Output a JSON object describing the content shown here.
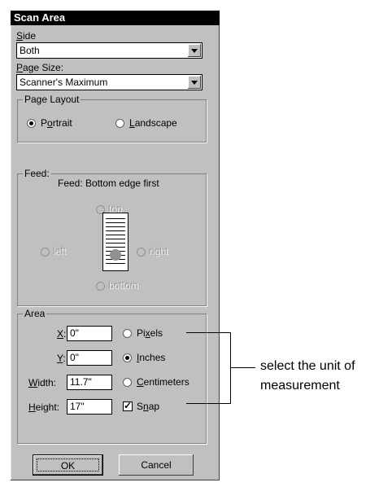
{
  "window": {
    "title": "Scan Area"
  },
  "side": {
    "label": "Side",
    "mnemonic": "S",
    "value": "Both"
  },
  "page_size": {
    "label": "Page Size:",
    "mnemonic": "P",
    "value": "Scanner's Maximum"
  },
  "page_layout": {
    "legend": "Page Layout",
    "portrait": {
      "label": "Portrait",
      "mnemonic": "o",
      "checked": true
    },
    "landscape": {
      "label": "Landscape",
      "mnemonic": "L",
      "checked": false
    }
  },
  "feed": {
    "legend": "Feed:",
    "description": "Feed: Bottom edge first",
    "top": "top",
    "left": "left",
    "right": "right",
    "bottom": "bottom"
  },
  "area": {
    "legend": "Area",
    "x": {
      "label": "X:",
      "mnemonic": "X",
      "value": "0\""
    },
    "y": {
      "label": "Y:",
      "mnemonic": "Y",
      "value": "0\""
    },
    "width": {
      "label": "Width:",
      "mnemonic": "W",
      "value": "11.7\""
    },
    "height": {
      "label": "Height:",
      "mnemonic": "H",
      "value": "17\""
    },
    "units": {
      "pixels": {
        "label": "Pixels",
        "checked": false
      },
      "inches": {
        "label": "Inches",
        "checked": true
      },
      "centimeters": {
        "label": "Centimeters",
        "checked": false
      }
    },
    "snap": {
      "label": "Snap",
      "checked": true
    }
  },
  "buttons": {
    "ok": "OK",
    "cancel": "Cancel"
  },
  "annotation": {
    "line1": "select the unit of",
    "line2": "measurement"
  }
}
